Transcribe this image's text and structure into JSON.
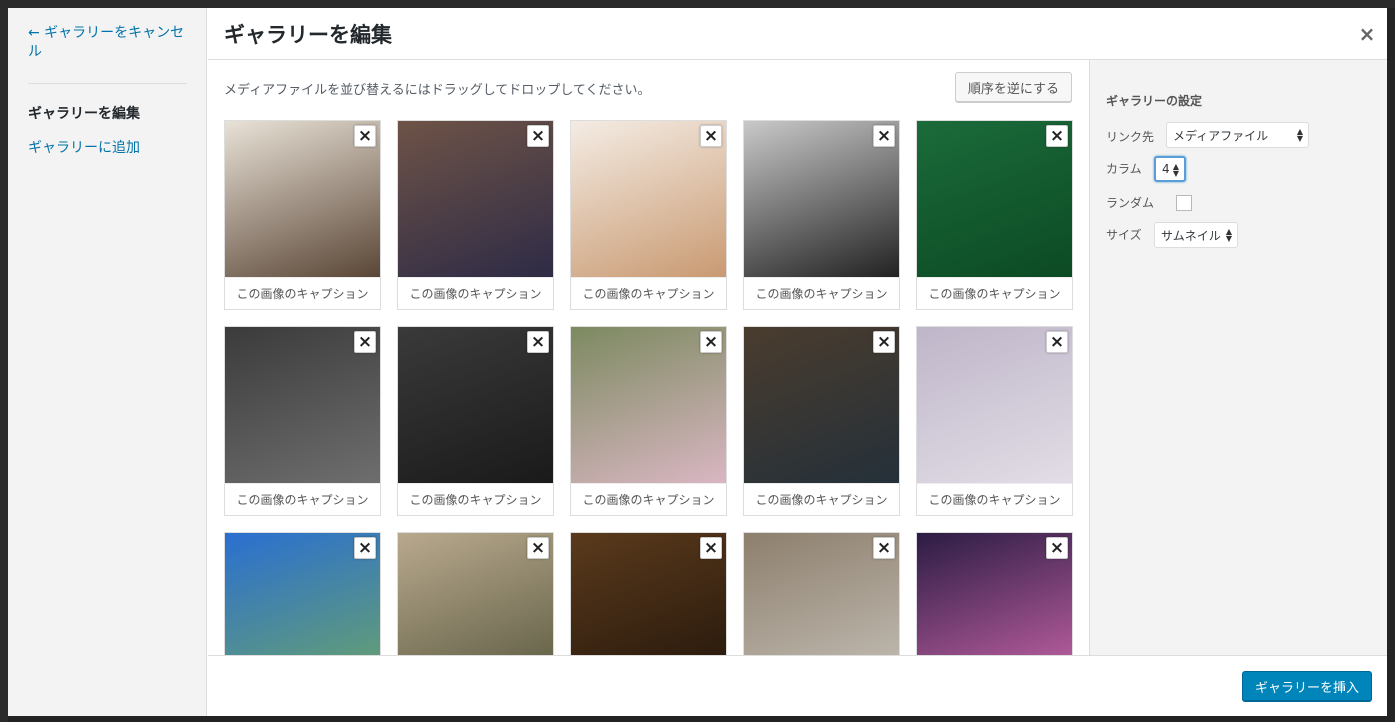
{
  "menu": {
    "cancel_label": "← ギャラリーをキャンセル",
    "items": [
      {
        "label": "ギャラリーを編集",
        "active": true
      },
      {
        "label": "ギャラリーに追加",
        "active": false
      }
    ]
  },
  "header": {
    "title": "ギャラリーを編集",
    "close_icon": "×"
  },
  "content": {
    "instruction": "メディアファイルを並び替えるにはドラッグしてドロップしてください。",
    "reverse_button": "順序を逆にする",
    "remove_icon": "×",
    "images": [
      {
        "caption": "この画像のキャプション",
        "colors": [
          "#e9e2d7",
          "#5a4636"
        ]
      },
      {
        "caption": "この画像のキャプション",
        "colors": [
          "#6e5347",
          "#2e2b46"
        ]
      },
      {
        "caption": "この画像のキャプション",
        "colors": [
          "#f4ece4",
          "#c99a72"
        ]
      },
      {
        "caption": "この画像のキャプション",
        "colors": [
          "#c9c9c9",
          "#222222"
        ]
      },
      {
        "caption": "この画像のキャプション",
        "colors": [
          "#1b6b3a",
          "#0c4a24"
        ]
      },
      {
        "caption": "この画像のキャプション",
        "colors": [
          "#3b3b3b",
          "#6e6e6e"
        ]
      },
      {
        "caption": "この画像のキャプション",
        "colors": [
          "#3a3a3a",
          "#1a1a1a"
        ]
      },
      {
        "caption": "この画像のキャプション",
        "colors": [
          "#7c8a60",
          "#d9b6c2"
        ]
      },
      {
        "caption": "この画像のキャプション",
        "colors": [
          "#4a3c2e",
          "#243039"
        ]
      },
      {
        "caption": "この画像のキャプション",
        "colors": [
          "#bfb6c9",
          "#e2dde6"
        ]
      },
      {
        "caption": "",
        "colors": [
          "#2a6fd1",
          "#6aa36b"
        ]
      },
      {
        "caption": "",
        "colors": [
          "#b9a98e",
          "#5a5a40"
        ]
      },
      {
        "caption": "",
        "colors": [
          "#5a3a1c",
          "#24160b"
        ]
      },
      {
        "caption": "",
        "colors": [
          "#8d7f6d",
          "#c4bfb6"
        ]
      },
      {
        "caption": "",
        "colors": [
          "#2b1c44",
          "#c864a8"
        ]
      }
    ]
  },
  "settings": {
    "title": "ギャラリーの設定",
    "link_label": "リンク先",
    "link_value": "メディアファイル",
    "columns_label": "カラム",
    "columns_value": "4",
    "random_label": "ランダム",
    "random_checked": false,
    "size_label": "サイズ",
    "size_value": "サムネイル"
  },
  "footer": {
    "insert_button": "ギャラリーを挿入"
  },
  "colors": {
    "accent": "#0085ba",
    "link": "#0073aa"
  }
}
